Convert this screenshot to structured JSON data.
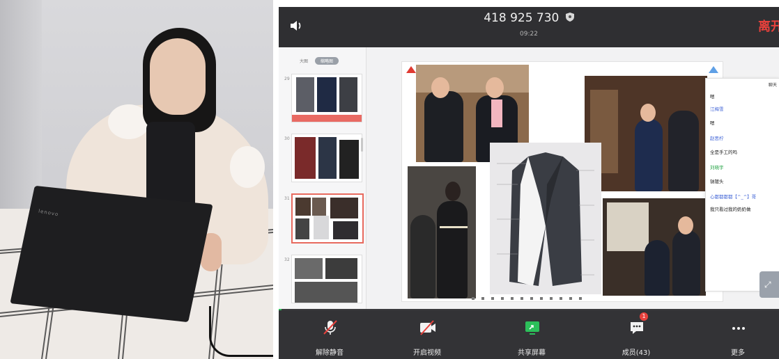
{
  "meeting": {
    "id": "418 925 730",
    "timer": "09:22",
    "leave_label": "离开"
  },
  "thumbnails": {
    "header_label": "大图",
    "header_pill": "缩略图",
    "items": [
      {
        "num": "29"
      },
      {
        "num": "30"
      },
      {
        "num": "31"
      },
      {
        "num": "32"
      }
    ]
  },
  "chat": {
    "title": "聊天",
    "messages": [
      {
        "text": "嗯",
        "type": "text"
      },
      {
        "text": "江梅雪",
        "type": "name"
      },
      {
        "text": "嗯",
        "type": "text"
      },
      {
        "text": "赵思柠",
        "type": "name"
      },
      {
        "text": "全是手工的吗",
        "type": "text"
      },
      {
        "text": "刘晓宇",
        "type": "green"
      },
      {
        "text": "钠镀头",
        "type": "text"
      },
      {
        "text": "心都都都都【^_^】哥",
        "type": "name"
      },
      {
        "text": "我只看过我的奶奶做",
        "type": "text"
      }
    ]
  },
  "toolbar": {
    "items": [
      {
        "label": "解除静音",
        "icon": "mic-muted-icon"
      },
      {
        "label": "开启视频",
        "icon": "video-off-icon"
      },
      {
        "label": "共享屏幕",
        "icon": "share-screen-icon"
      },
      {
        "label": "成员(43)",
        "icon": "members-icon"
      },
      {
        "label": "更多",
        "icon": "more-icon"
      }
    ],
    "badge": "1"
  },
  "photo": {
    "laptop_brand": "lenovo"
  },
  "colors": {
    "leave": "#e8413c",
    "share_green": "#2cbf5a",
    "active_thumb": "#e86a5e"
  }
}
